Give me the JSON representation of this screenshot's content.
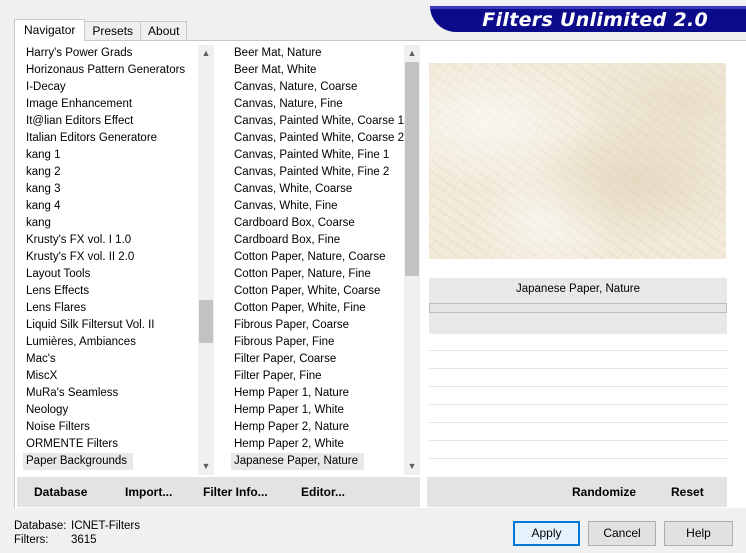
{
  "tabs": [
    "Navigator",
    "Presets",
    "About"
  ],
  "active_tab": "Navigator",
  "banner_title": "Filters Unlimited 2.0",
  "categories": [
    "Harry's Power Grads",
    "Horizonaus Pattern Generators",
    "I-Decay",
    "Image Enhancement",
    "It@lian Editors Effect",
    "Italian Editors Generatore",
    "kang 1",
    "kang 2",
    "kang 3",
    "kang 4",
    "kang",
    "Krusty's FX vol. I 1.0",
    "Krusty's FX vol. II 2.0",
    "Layout Tools",
    "Lens Effects",
    "Lens Flares",
    "Liquid Silk Filtersut Vol. II",
    "Lumières, Ambiances",
    "Mac's",
    "MiscX",
    "MuRa's Seamless",
    "Neology",
    "Noise Filters",
    "ORMENTE Filters",
    "Paper Backgrounds"
  ],
  "selected_category": "Paper Backgrounds",
  "filters": [
    "Beer Mat, Nature",
    "Beer Mat, White",
    "Canvas, Nature, Coarse",
    "Canvas, Nature, Fine",
    "Canvas, Painted White, Coarse 1",
    "Canvas, Painted White, Coarse 2",
    "Canvas, Painted White, Fine 1",
    "Canvas, Painted White, Fine 2",
    "Canvas, White, Coarse",
    "Canvas, White, Fine",
    "Cardboard Box, Coarse",
    "Cardboard Box, Fine",
    "Cotton Paper, Nature, Coarse",
    "Cotton Paper, Nature, Fine",
    "Cotton Paper, White, Coarse",
    "Cotton Paper, White, Fine",
    "Fibrous Paper, Coarse",
    "Fibrous Paper, Fine",
    "Filter Paper, Coarse",
    "Filter Paper, Fine",
    "Hemp Paper 1, Nature",
    "Hemp Paper 1, White",
    "Hemp Paper 2, Nature",
    "Hemp Paper 2, White",
    "Japanese Paper, Nature"
  ],
  "selected_filter": "Japanese Paper, Nature",
  "preview_filter_name": "Japanese Paper, Nature",
  "left_buttons": {
    "database": "Database",
    "import": "Import...",
    "filter_info": "Filter Info...",
    "editor": "Editor..."
  },
  "right_buttons": {
    "randomize": "Randomize",
    "reset": "Reset"
  },
  "status": {
    "database_label": "Database:",
    "database_value": "ICNET-Filters",
    "filters_label": "Filters:",
    "filters_value": "3615"
  },
  "dialog_buttons": {
    "apply": "Apply",
    "cancel": "Cancel",
    "help": "Help"
  },
  "colors": {
    "banner": "#0c0c8a",
    "selection": "#e8e8e8",
    "default_button_border": "#0078d7"
  }
}
